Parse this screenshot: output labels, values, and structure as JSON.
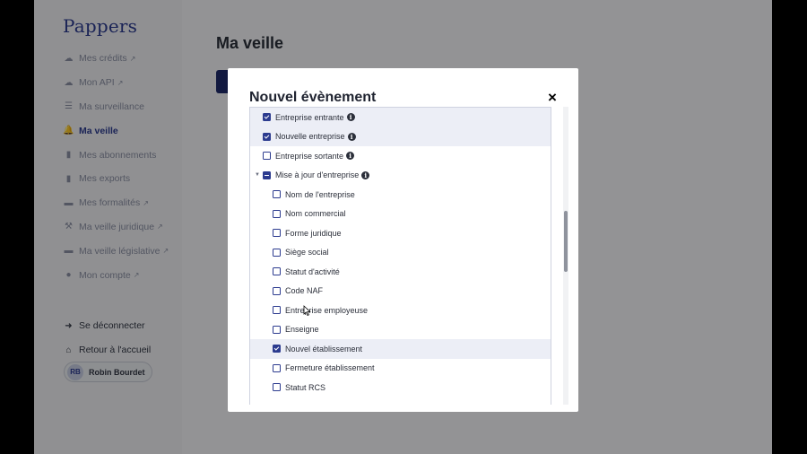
{
  "brand": "Pappers",
  "sidebar": {
    "items": [
      {
        "label": "Mes crédits",
        "icon": "cloud-icon",
        "external": true
      },
      {
        "label": "Mon API",
        "icon": "cloud-icon",
        "external": true
      },
      {
        "label": "Ma surveillance",
        "icon": "list-icon",
        "external": false
      },
      {
        "label": "Ma veille",
        "icon": "bell-icon",
        "external": false,
        "active": true
      },
      {
        "label": "Mes abonnements",
        "icon": "file-icon",
        "external": false
      },
      {
        "label": "Mes exports",
        "icon": "file-export-icon",
        "external": false
      },
      {
        "label": "Mes formalités",
        "icon": "folder-icon",
        "external": true
      },
      {
        "label": "Ma veille juridique",
        "icon": "gavel-icon",
        "external": true
      },
      {
        "label": "Ma veille législative",
        "icon": "folder-open-icon",
        "external": true
      },
      {
        "label": "Mon compte",
        "icon": "user-circle-icon",
        "external": true
      }
    ],
    "logout": "Se déconnecter",
    "home": "Retour à l'accueil",
    "user": {
      "initials": "RB",
      "name": "Robin Bourdet"
    }
  },
  "main": {
    "title": "Ma veille"
  },
  "modal": {
    "title": "Nouvel évènement",
    "close": "×",
    "events": [
      {
        "label": "Entreprise entrante",
        "checked": true,
        "info": true,
        "level": 0,
        "highlight": true
      },
      {
        "label": "Nouvelle entreprise",
        "checked": true,
        "info": true,
        "level": 0,
        "highlight": true
      },
      {
        "label": "Entreprise sortante",
        "checked": false,
        "info": true,
        "level": 0,
        "highlight": false
      },
      {
        "label": "Mise à jour d'entreprise",
        "checked": "partial",
        "info": true,
        "level": 0,
        "highlight": false,
        "expanded": true
      },
      {
        "label": "Nom de l'entreprise",
        "checked": false,
        "info": false,
        "level": 1,
        "highlight": false
      },
      {
        "label": "Nom commercial",
        "checked": false,
        "info": false,
        "level": 1,
        "highlight": false
      },
      {
        "label": "Forme juridique",
        "checked": false,
        "info": false,
        "level": 1,
        "highlight": false
      },
      {
        "label": "Siège social",
        "checked": false,
        "info": false,
        "level": 1,
        "highlight": false
      },
      {
        "label": "Statut d'activité",
        "checked": false,
        "info": false,
        "level": 1,
        "highlight": false
      },
      {
        "label": "Code NAF",
        "checked": false,
        "info": false,
        "level": 1,
        "highlight": false
      },
      {
        "label": "Entreprise employeuse",
        "checked": false,
        "info": false,
        "level": 1,
        "highlight": false
      },
      {
        "label": "Enseigne",
        "checked": false,
        "info": false,
        "level": 1,
        "highlight": false
      },
      {
        "label": "Nouvel établissement",
        "checked": true,
        "info": false,
        "level": 1,
        "highlight": true
      },
      {
        "label": "Fermeture établissement",
        "checked": false,
        "info": false,
        "level": 1,
        "highlight": false
      },
      {
        "label": "Statut RCS",
        "checked": false,
        "info": false,
        "level": 1,
        "highlight": false
      }
    ]
  },
  "colors": {
    "brand": "#2c3b8f",
    "highlight": "#eceef6"
  }
}
